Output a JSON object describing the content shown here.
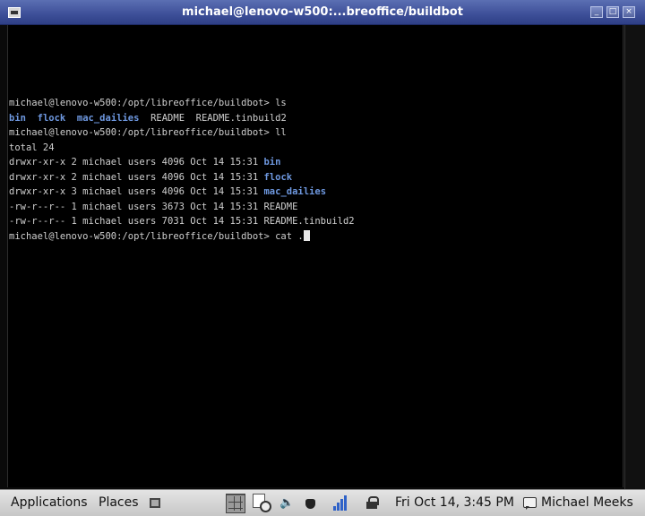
{
  "window": {
    "title": "michael@lenovo-w500:...breoffice/buildbot",
    "buttons": {
      "minimize": "_",
      "maximize": "□",
      "close": "×"
    }
  },
  "terminal": {
    "lines": [
      {
        "segments": [
          {
            "text": "michael@lenovo-w500:/opt/libreoffice/buildbot> ls",
            "style": "normal"
          }
        ]
      },
      {
        "segments": [
          {
            "text": "bin",
            "style": "dir"
          },
          {
            "text": "  ",
            "style": "normal"
          },
          {
            "text": "flock",
            "style": "dir"
          },
          {
            "text": "  ",
            "style": "normal"
          },
          {
            "text": "mac_dailies",
            "style": "dir"
          },
          {
            "text": "  README  README.tinbuild2",
            "style": "normal"
          }
        ]
      },
      {
        "segments": [
          {
            "text": "michael@lenovo-w500:/opt/libreoffice/buildbot> ll",
            "style": "normal"
          }
        ]
      },
      {
        "segments": [
          {
            "text": "total 24",
            "style": "normal"
          }
        ]
      },
      {
        "segments": [
          {
            "text": "drwxr-xr-x 2 michael users 4096 Oct 14 15:31 ",
            "style": "normal"
          },
          {
            "text": "bin",
            "style": "dir"
          }
        ]
      },
      {
        "segments": [
          {
            "text": "drwxr-xr-x 2 michael users 4096 Oct 14 15:31 ",
            "style": "normal"
          },
          {
            "text": "flock",
            "style": "dir"
          }
        ]
      },
      {
        "segments": [
          {
            "text": "drwxr-xr-x 3 michael users 4096 Oct 14 15:31 ",
            "style": "normal"
          },
          {
            "text": "mac_dailies",
            "style": "dir"
          }
        ]
      },
      {
        "segments": [
          {
            "text": "-rw-r--r-- 1 michael users 3673 Oct 14 15:31 README",
            "style": "normal"
          }
        ]
      },
      {
        "segments": [
          {
            "text": "-rw-r--r-- 1 michael users 7031 Oct 14 15:31 README.tinbuild2",
            "style": "normal"
          }
        ]
      },
      {
        "segments": [
          {
            "text": "michael@lenovo-w500:/opt/libreoffice/buildbot> cat .",
            "style": "normal"
          }
        ],
        "cursor": true
      }
    ]
  },
  "panel": {
    "applications": "Applications",
    "places": "Places",
    "volume_glyph": "🔈",
    "clock": "Fri Oct 14,  3:45 PM",
    "user": "Michael Meeks"
  },
  "colors": {
    "titlebar": "#3d4f98",
    "directory": "#6e98e0",
    "terminal_text": "#cfcfcf",
    "panel": "#d6d6d6"
  },
  "icons": [
    "window-menu-icon",
    "screenshot-icon",
    "workspace-switcher-icon",
    "clock-app-icon",
    "volume-icon",
    "power-icon",
    "network-icon",
    "lock-icon",
    "chat-icon"
  ]
}
